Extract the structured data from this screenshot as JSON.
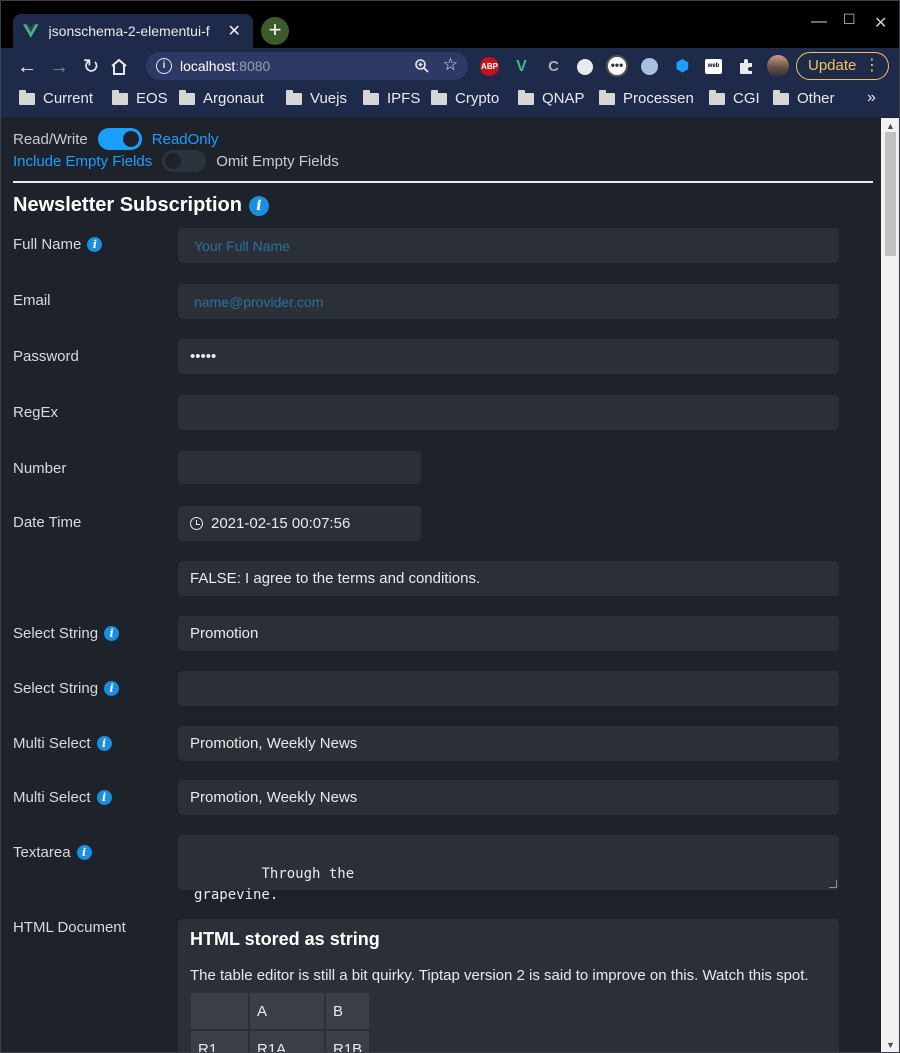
{
  "browser": {
    "tab_title": "jsonschema-2-elementui-f",
    "url_host": "localhost",
    "url_port": ":8080",
    "update_label": "Update",
    "bookmarks": [
      "Current",
      "EOS",
      "Argonaut",
      "Vuejs",
      "IPFS",
      "Crypto",
      "QNAP",
      "Processen",
      "CGI",
      "Other"
    ],
    "extensions": [
      "ABP",
      "V",
      "C",
      "",
      "",
      "",
      "",
      "web",
      "",
      ""
    ]
  },
  "toggles": {
    "rw_left": "Read/Write",
    "rw_right": "ReadOnly",
    "empty_left": "Include Empty Fields",
    "empty_right": "Omit Empty Fields"
  },
  "form": {
    "title": "Newsletter Subscription",
    "full_name": {
      "label": "Full Name",
      "placeholder": "Your Full Name"
    },
    "email": {
      "label": "Email",
      "placeholder": "name@provider.com"
    },
    "password": {
      "label": "Password",
      "value": "•••••"
    },
    "regex": {
      "label": "RegEx",
      "value": ""
    },
    "number": {
      "label": "Number",
      "value": ""
    },
    "datetime": {
      "label": "Date Time",
      "value": "2021-02-15 00:07:56"
    },
    "agree": {
      "value": "FALSE: I agree to the terms and conditions."
    },
    "select1": {
      "label": "Select String",
      "value": "Promotion"
    },
    "select2": {
      "label": "Select String",
      "value": ""
    },
    "multi1": {
      "label": "Multi Select",
      "value": "Promotion, Weekly News"
    },
    "multi2": {
      "label": "Multi Select",
      "value": "Promotion, Weekly News"
    },
    "textarea": {
      "label": "Textarea",
      "value": "Through the\ngrapevine."
    },
    "htmldoc": {
      "label": "HTML Document",
      "heading": "HTML stored as string",
      "paragraph": "The table editor is still a bit quirky. Tiptap version 2 is said to improve on this. Watch this spot.",
      "table": [
        [
          "",
          "A",
          "B"
        ],
        [
          "R1",
          "R1A",
          "R1B"
        ]
      ]
    }
  },
  "colors": {
    "accent": "#1a9fff",
    "field_bg": "#2b3038",
    "page_bg": "#1e222a",
    "update": "#f6c35a"
  }
}
